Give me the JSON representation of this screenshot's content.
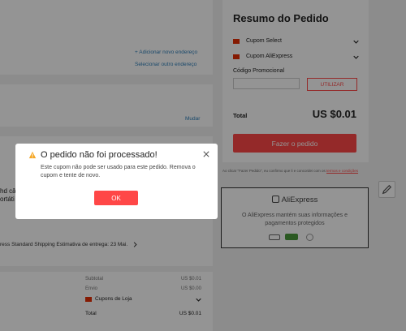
{
  "left": {
    "address_links": [
      "+ Adicionar novo endereço",
      "Selecionar outro endereço"
    ],
    "change_link": "Mudar",
    "partial_text_1": "hd câ",
    "partial_text_2": "ortáti",
    "shipping_text": "ress Standard Shipping  Estimativa de entrega: 23 Mai.",
    "summary_rows": [
      {
        "label": "Subtotal",
        "value": "US $0.01"
      },
      {
        "label": "Envio",
        "value": "US $0.00"
      }
    ],
    "store_coupons_label": "Cupons de Loja",
    "total_label": "Total",
    "total_value": "US $0.01"
  },
  "summary": {
    "title": "Resumo do Pedido",
    "coupon_select": "Cupom Select",
    "coupon_aliexpress": "Cupom AliExpress",
    "promo_label": "Código Promocional",
    "promo_placeholder": "",
    "apply_button": "UTILIZAR",
    "total_label": "Total",
    "total_value": "US $0.01",
    "place_order_button": "Fazer o pedido",
    "terms_text": "Ao clicar \"Fazer Pedido\", eu confirmo que li e concordei com os",
    "terms_link": "termos e condições",
    "aliexpress_logo": "AliExpress",
    "protection_text": "O AliExpress mantém suas informações e pagamentos protegidos",
    "colors": {
      "accent": "#ff4747",
      "coupon_flag": "#e62e04"
    }
  },
  "modal": {
    "title": "O pedido não foi processado!",
    "message": "Este cupom não pode ser usado para este pedido. Remova o cupom e tente de novo.",
    "ok_button": "OK",
    "icon": "warning-icon",
    "colors": {
      "warning": "#f5a623",
      "button": "#ff4747"
    }
  }
}
